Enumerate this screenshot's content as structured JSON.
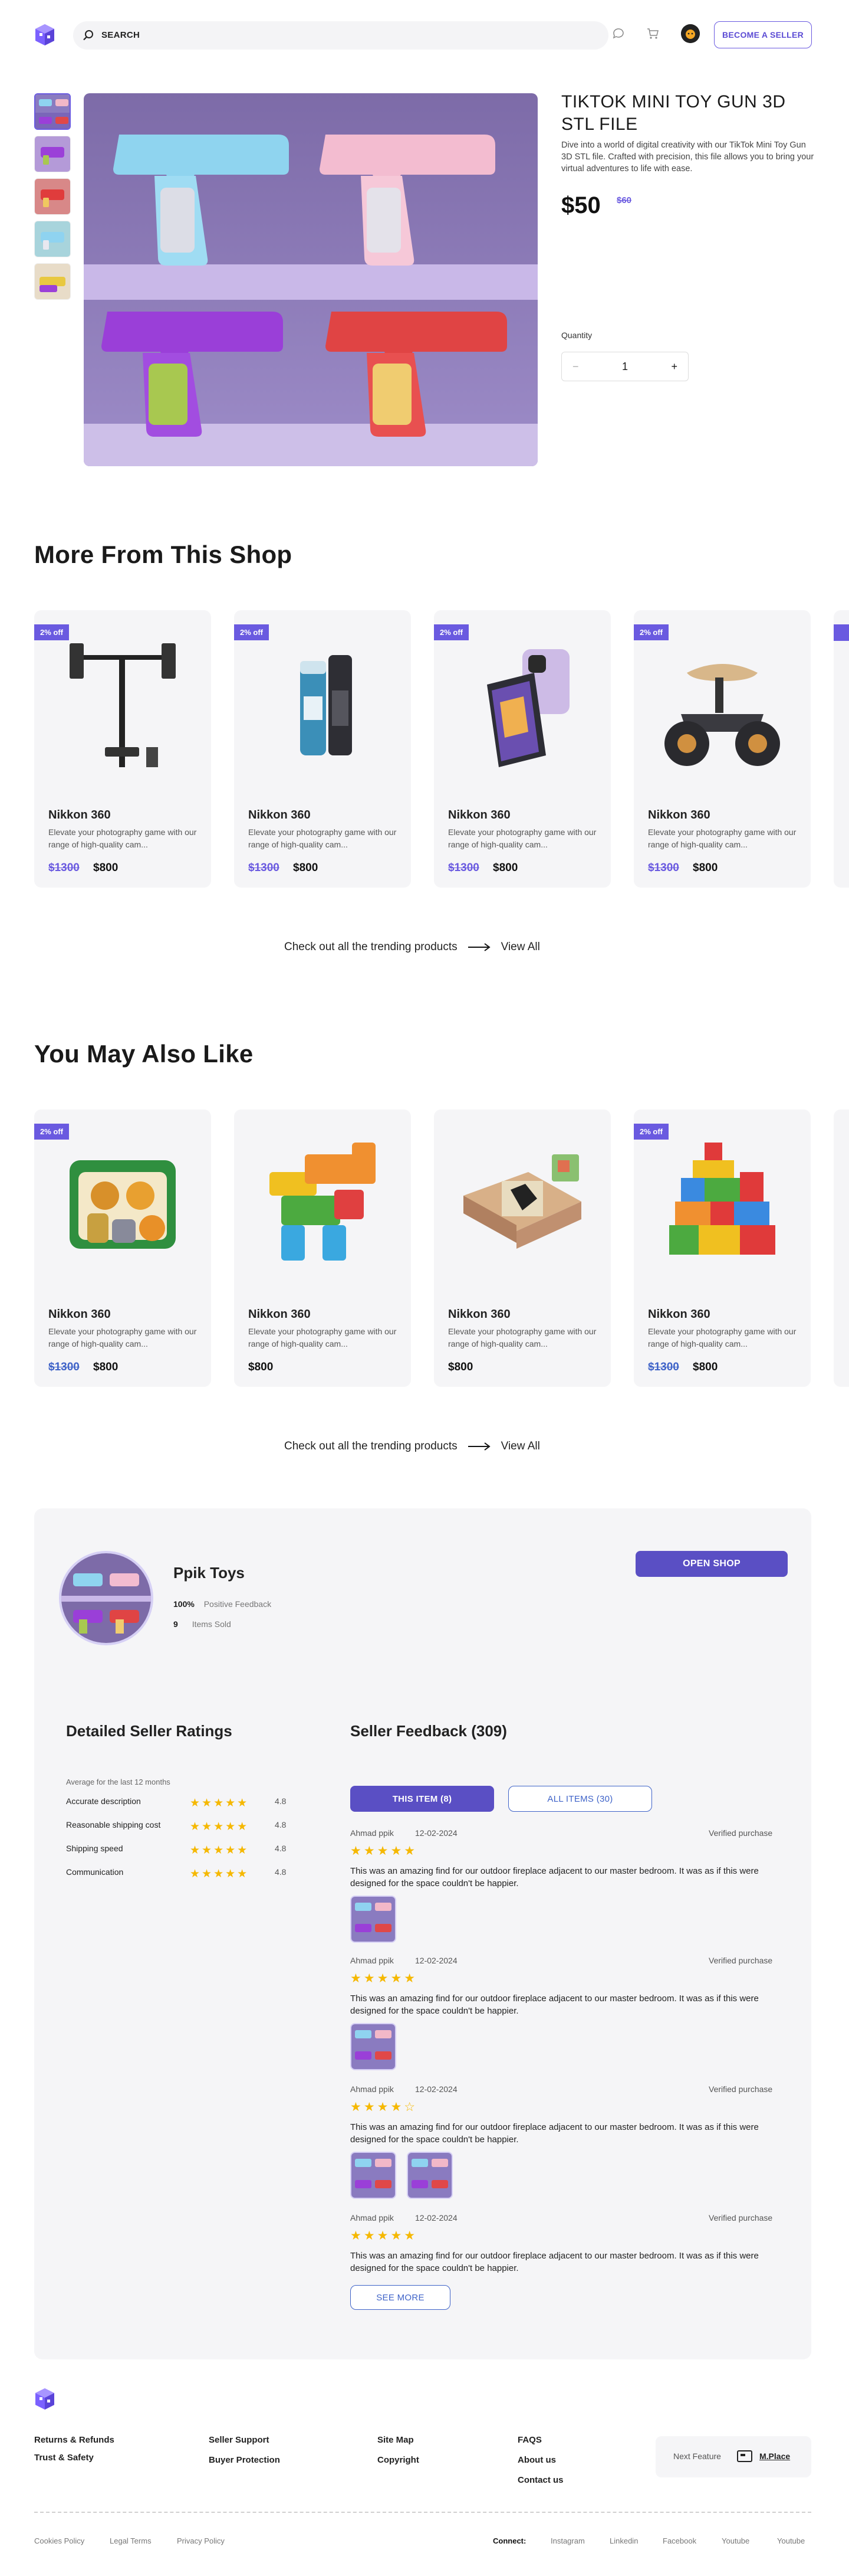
{
  "header": {
    "search_placeholder": "SEARCH",
    "become_seller": "BECOME A SELLER"
  },
  "product": {
    "title": "TIKTOK MINI TOY GUN 3D STL FILE",
    "description": "Dive into a world of digital creativity with our TikTok Mini Toy Gun 3D STL file. Crafted with precision, this file allows you to bring your virtual adventures to life with ease.",
    "price": "$50",
    "old_price": "$60",
    "quantity_label": "Quantity",
    "quantity": "1",
    "minus": "−",
    "plus": "+"
  },
  "more_from_shop": {
    "title": "More From This Shop",
    "cards": [
      {
        "badge": "2% off",
        "name": "Nikkon 360",
        "desc": "Elevate your photography game with our range of high-quality cam...",
        "old": "$1300",
        "price": "$800",
        "img": "monitor-arm"
      },
      {
        "badge": "2% off",
        "name": "Nikkon 360",
        "desc": "Elevate your photography game with our range of high-quality cam...",
        "old": "$1300",
        "price": "$800",
        "img": "skincare"
      },
      {
        "badge": "2% off",
        "name": "Nikkon 360",
        "desc": "Elevate your photography game with our range of high-quality cam...",
        "old": "$1300",
        "price": "$800",
        "img": "flip-phone"
      },
      {
        "badge": "2% off",
        "name": "Nikkon 360",
        "desc": "Elevate your photography game with our range of high-quality cam...",
        "old": "$1300",
        "price": "$800",
        "img": "balance-bike"
      }
    ],
    "trend_text": "Check out all the trending products",
    "view_all": "View All"
  },
  "you_may_like": {
    "title": "You May Also Like",
    "cards": [
      {
        "badge": "2% off",
        "name": "Nikkon 360",
        "desc": "Elevate your photography game with our range of high-quality cam...",
        "old": "$1300",
        "price": "$800"
      },
      {
        "badge": "",
        "name": "Nikkon 360",
        "desc": "Elevate your photography game with our range of high-quality cam...",
        "old": "",
        "price": "$800"
      },
      {
        "badge": "",
        "name": "Nikkon 360",
        "desc": "Elevate your photography game with our range of high-quality cam...",
        "old": "",
        "price": "$800"
      },
      {
        "badge": "2% off",
        "name": "Nikkon 360",
        "desc": "Elevate your photography game with our range of high-quality cam...",
        "old": "$1300",
        "price": "$800"
      }
    ],
    "trend_text": "Check out all the trending products",
    "view_all": "View All"
  },
  "seller": {
    "name": "Ppik Toys",
    "feedback_value": "100%",
    "feedback_label": "Positive Feedback",
    "sold_value": "9",
    "sold_label": "Items Sold",
    "open_shop": "OPEN SHOP",
    "ratings_title": "Detailed Seller Ratings",
    "ratings_period": "Average for the last 12 months",
    "ratings": [
      {
        "label": "Accurate description",
        "value": "4.8"
      },
      {
        "label": "Reasonable shipping cost",
        "value": "4.8"
      },
      {
        "label": "Shipping speed",
        "value": "4.8"
      },
      {
        "label": "Communication",
        "value": "4.8"
      }
    ],
    "feedback_title": "Seller Feedback (309)",
    "tab_this": "THIS ITEM (8)",
    "tab_all": "ALL ITEMS (30)",
    "reviews": [
      {
        "name": "Ahmad ppik",
        "date": "12-02-2024",
        "verified": "Verified purchase",
        "stars": "★★★★★",
        "text": "This was an amazing find for our outdoor fireplace adjacent to our master bedroom. It was as if this were designed for the space couldn't be happier."
      },
      {
        "name": "Ahmad ppik",
        "date": "12-02-2024",
        "verified": "Verified purchase",
        "stars": "★★★★★",
        "text": "This was an amazing find for our outdoor fireplace adjacent to our master bedroom. It was as if this were designed for the space couldn't be happier."
      },
      {
        "name": "Ahmad ppik",
        "date": "12-02-2024",
        "verified": "Verified purchase",
        "stars": "★★★★☆",
        "text": "This was an amazing find for our outdoor fireplace adjacent to our master bedroom. It was as if this were designed for the space couldn't be happier."
      },
      {
        "name": "Ahmad ppik",
        "date": "12-02-2024",
        "verified": "Verified purchase",
        "stars": "★★★★★",
        "text": "This was an amazing find for our outdoor fireplace adjacent to our master bedroom. It was as if this were designed for the space couldn't be happier."
      }
    ],
    "see_more": "SEE MORE"
  },
  "footer": {
    "col1": [
      "Returns & Refunds",
      "Trust & Safety"
    ],
    "col2": [
      "Seller Support",
      "Buyer Protection"
    ],
    "col3": [
      "Site Map",
      "Copyright"
    ],
    "col4": [
      "FAQS",
      "About us",
      "Contact us"
    ],
    "next_feature": "Next Feature",
    "mplace": "M.Place",
    "bottom_links": [
      "Cookies Policy",
      "Legal Terms",
      "Privacy Policy"
    ],
    "connect_label": "Connect:",
    "socials": [
      "Instagram",
      "Linkedin",
      "Facebook",
      "Youtube",
      "Youtube"
    ]
  },
  "colors": {
    "accent": "#6a5ae0",
    "button": "#5a4fc4",
    "star": "#f5b800",
    "panel": "#f5f5f7"
  }
}
